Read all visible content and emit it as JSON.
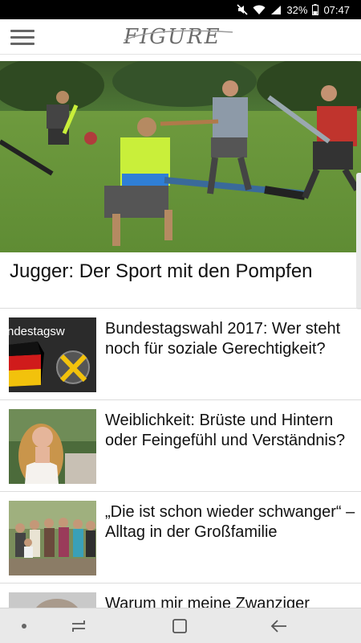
{
  "status_bar": {
    "battery": "32%",
    "time": "07:47",
    "icons": [
      "mute-icon",
      "wifi-icon",
      "signal-icon",
      "battery-icon"
    ]
  },
  "header": {
    "brand": "FIGURE",
    "menu_icon": "hamburger-menu-icon"
  },
  "hero": {
    "title": "Jugger: Der Sport mit den Pompfen"
  },
  "articles": [
    {
      "title": "Bundestagswahl 2017: Wer steht noch für soziale Gerechtigkeit?",
      "thumb_text": "ndestagsw"
    },
    {
      "title": "Weiblichkeit: Brüste und Hintern oder Feingefühl und Verständnis?"
    },
    {
      "title": "„Die ist schon wieder schwanger“ – Alltag in der Großfamilie"
    },
    {
      "title": "Warum mir meine Zwanziger"
    }
  ],
  "nav": {
    "items": [
      "dot-icon",
      "recent-apps-icon",
      "home-icon",
      "back-icon"
    ]
  },
  "colors": {
    "header_bg": "#ffffff",
    "logo_gray": "#6b6b6b",
    "nav_bg": "#e9e9e9",
    "status_bg": "#000000"
  }
}
